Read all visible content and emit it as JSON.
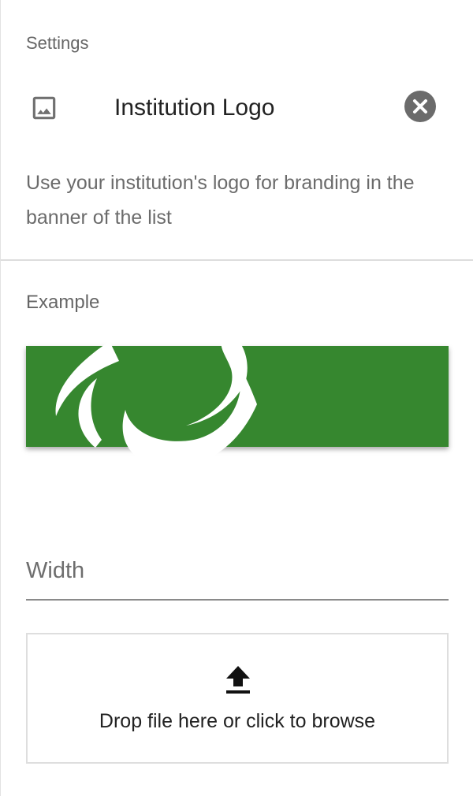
{
  "panel": {
    "section_label": "Settings",
    "title": "Institution Logo",
    "description": "Use your institution's logo for branding in the banner of the list",
    "icons": {
      "header": "image-icon",
      "close": "close-icon",
      "upload": "upload-icon"
    }
  },
  "example": {
    "label": "Example",
    "banner_color": "#36872f",
    "logo_color": "#ffffff"
  },
  "width_field": {
    "label": "Width",
    "value": ""
  },
  "dropzone": {
    "text": "Drop file here or click to browse"
  }
}
